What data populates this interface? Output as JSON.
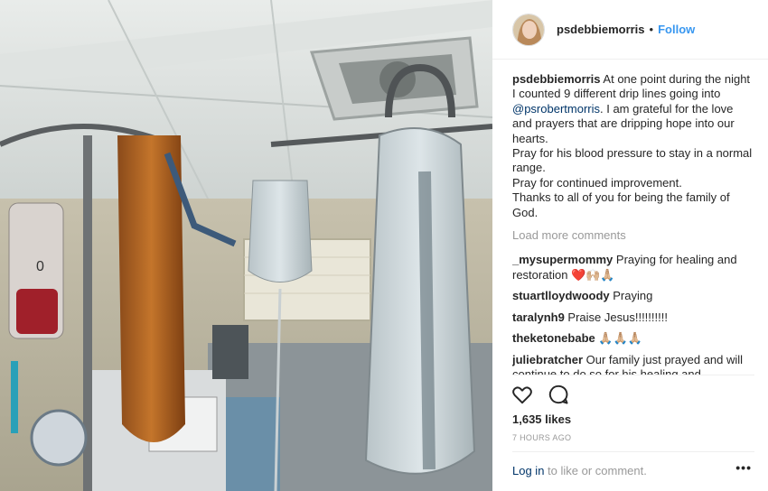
{
  "post": {
    "username": "psdebbiemorris",
    "separator": "•",
    "follow_label": "Follow",
    "caption": {
      "username": "psdebbiemorris",
      "line1_text": " At one point during the night I counted 9 different drip lines going into ",
      "mention": "@psrobertmorris",
      "line1_end": ". I am grateful for the love and prayers that are dripping hope into our hearts.",
      "line2": "Pray for his blood pressure to stay in a normal range.",
      "line3": "Pray for continued improvement.",
      "line4": "Thanks to all of you for being the family of God."
    },
    "load_more_label": "Load more comments",
    "comments": [
      {
        "user": "_mysupermommy",
        "text": " Praying for healing and restoration ❤️🙌🏼🙏🏼"
      },
      {
        "user": "stuartlloydwoody",
        "text": " Praying"
      },
      {
        "user": "taralynh9",
        "text": " Praise Jesus!!!!!!!!!!"
      },
      {
        "user": "theketonebabe",
        "text": " 🙏🏼🙏🏼🙏🏼"
      },
      {
        "user": "juliebratcher",
        "text": " Our family just prayed and will continue to do so for his healing and"
      }
    ],
    "icons": {
      "like": "heart-icon",
      "comment": "comment-bubble-icon",
      "more": "more-dots-icon"
    },
    "likes": "1,635 likes",
    "time": "7 HOURS AGO",
    "login_link": "Log in",
    "login_rest": " to like or comment.",
    "more_label": "•••"
  }
}
